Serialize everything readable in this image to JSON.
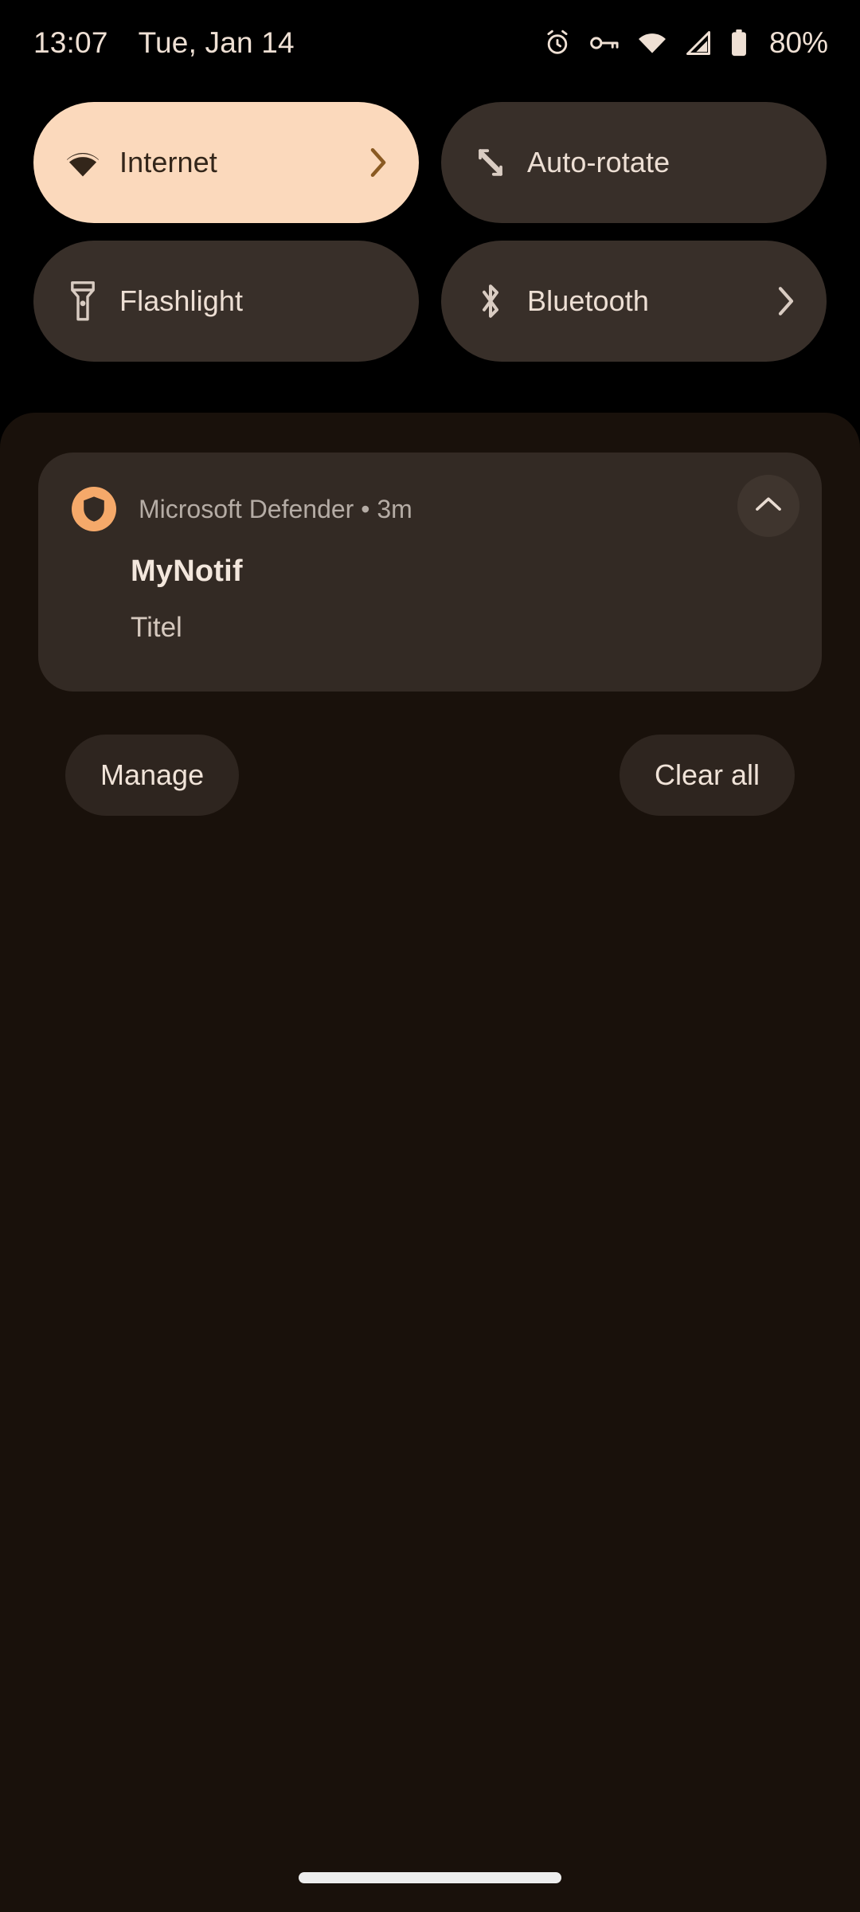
{
  "status_bar": {
    "time": "13:07",
    "date": "Tue, Jan 14",
    "battery_percent": "80%",
    "icons": [
      "alarm-icon",
      "vpn-key-icon",
      "wifi-icon",
      "cellular-signal-icon",
      "battery-icon"
    ],
    "text_color": "#EFE0D4"
  },
  "quick_settings": {
    "tiles": [
      {
        "label": "Internet",
        "icon": "wifi-icon",
        "active": true,
        "has_chevron": true
      },
      {
        "label": "Auto-rotate",
        "icon": "auto-rotate-icon",
        "active": false,
        "has_chevron": false
      },
      {
        "label": "Flashlight",
        "icon": "flashlight-icon",
        "active": false,
        "has_chevron": false
      },
      {
        "label": "Bluetooth",
        "icon": "bluetooth-icon",
        "active": false,
        "has_chevron": true
      }
    ],
    "active_tile_bg": "#FBD9BC",
    "active_tile_fg": "#33261A",
    "inactive_tile_bg": "#382F29",
    "inactive_tile_fg": "#EDDFD4"
  },
  "notification": {
    "app_name": "Microsoft Defender",
    "separator": "•",
    "time_ago": "3m",
    "meta_line": "Microsoft Defender • 3m",
    "title": "MyNotif",
    "body": "Titel",
    "app_icon": "shield-icon",
    "app_icon_color": "#F5A96A",
    "expand_icon": "chevron-up-icon",
    "card_bg": "#332A24"
  },
  "actions": {
    "manage_label": "Manage",
    "clear_all_label": "Clear all"
  },
  "shade": {
    "background": "#19110B"
  }
}
